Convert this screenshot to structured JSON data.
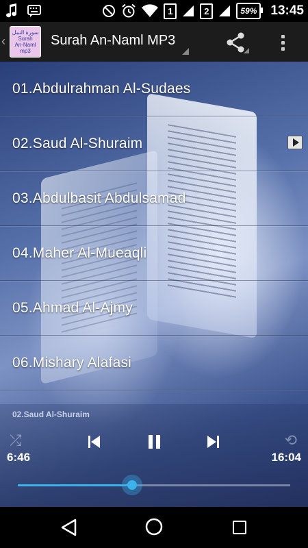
{
  "status_bar": {
    "sim1": "1",
    "sim2": "2",
    "battery": "59%",
    "time": "13:45",
    "icons": [
      "music-note-icon",
      "keyboard-icon",
      "do-not-disturb-icon",
      "alarm-icon",
      "wifi-icon",
      "signal-icon",
      "signal-icon",
      "battery-icon"
    ]
  },
  "action_bar": {
    "app_icon_lines": [
      "سورة النمل",
      "Surah",
      "An-Naml mp3"
    ],
    "title": "Surah An-Naml MP3",
    "share_icon": "share-icon",
    "menu_icon": "overflow-menu-icon"
  },
  "tracks": [
    {
      "label": "01.Abdulrahman Al-Sudaes",
      "playing": false
    },
    {
      "label": "02.Saud Al-Shuraim",
      "playing": true
    },
    {
      "label": "03.Abdulbasit Abdulsamad",
      "playing": false
    },
    {
      "label": "04.Maher Al-Mueaqli",
      "playing": false
    },
    {
      "label": "05.Ahmad Al-Ajmy",
      "playing": false
    },
    {
      "label": "06.Mishary Alafasi",
      "playing": false
    }
  ],
  "player": {
    "now_playing": "02.Saud Al-Shuraim",
    "elapsed": "6:46",
    "total": "16:04",
    "progress_fraction": 0.42,
    "accent_color": "#39b3ea"
  },
  "nav_bar": {
    "icons": [
      "back-icon",
      "home-icon",
      "recent-apps-icon"
    ]
  }
}
